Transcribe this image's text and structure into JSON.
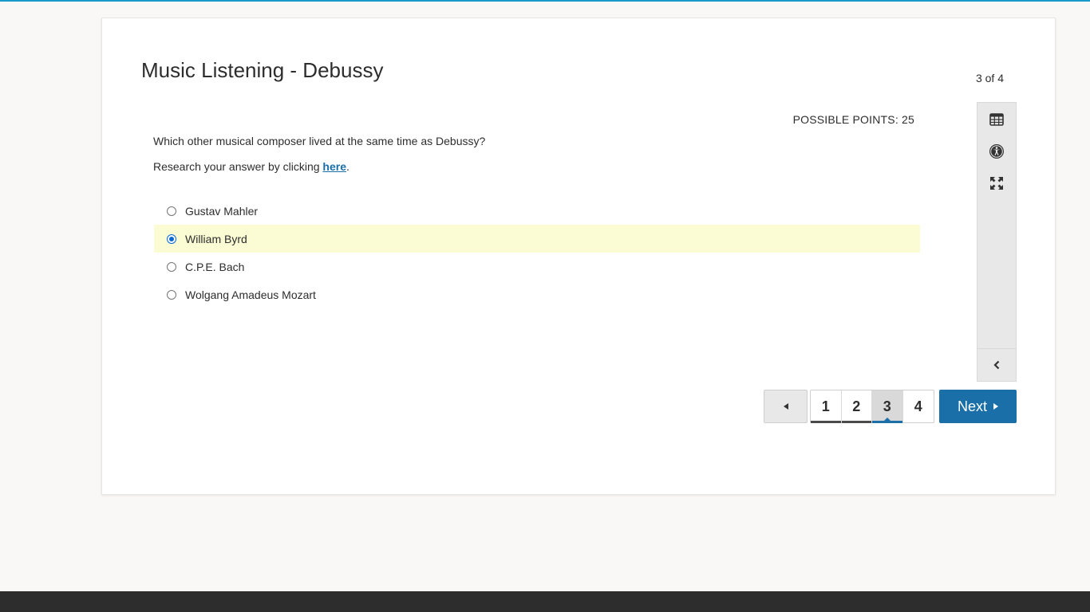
{
  "quiz": {
    "title": "Music Listening - Debussy",
    "page_count": "3 of 4",
    "possible_points": "POSSIBLE POINTS: 25",
    "question": "Which other musical composer lived at the same time as Debussy?",
    "research_prefix": "Research your answer by clicking ",
    "research_link": "here",
    "research_suffix": "."
  },
  "answers": [
    {
      "label": "Gustav Mahler",
      "selected": false
    },
    {
      "label": "William Byrd",
      "selected": true
    },
    {
      "label": "C.P.E. Bach",
      "selected": false
    },
    {
      "label": "Wolgang Amadeus Mozart",
      "selected": false
    }
  ],
  "toolbar": {
    "icons": [
      "calculator-icon",
      "accessibility-icon",
      "expand-icon"
    ],
    "collapse_icon": "chevron-left-icon"
  },
  "pager": {
    "pages": [
      "1",
      "2",
      "3",
      "4"
    ],
    "current_page": "3",
    "next_label": "Next"
  },
  "colors": {
    "accent": "#1a6fa8",
    "selected_answer_bg": "#fbfbd4",
    "top_line": "#1a9ac9",
    "footer": "#2d2d2d"
  }
}
